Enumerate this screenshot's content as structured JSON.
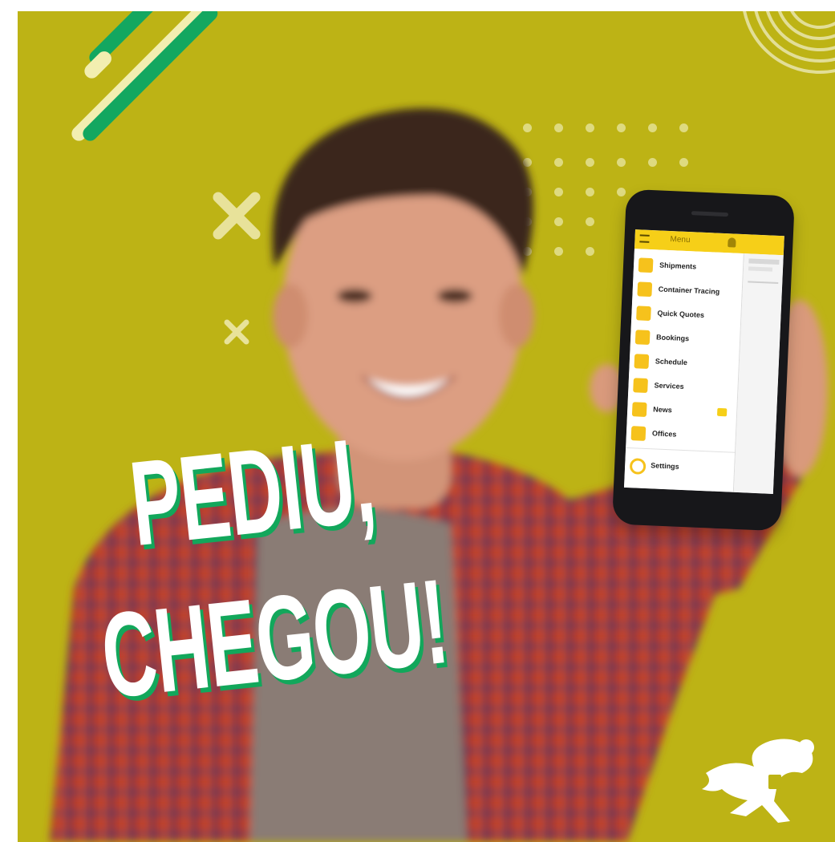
{
  "headline": {
    "line1": "PEDIU,",
    "line2": "CHEGOU!"
  },
  "phone_app": {
    "title": "Menu",
    "menu_items": [
      {
        "label": "Shipments",
        "icon": "clipboard-icon"
      },
      {
        "label": "Container Tracing",
        "icon": "container-icon"
      },
      {
        "label": "Quick Quotes",
        "icon": "tag-icon"
      },
      {
        "label": "Bookings",
        "icon": "booking-icon"
      },
      {
        "label": "Schedule",
        "icon": "calendar-icon"
      },
      {
        "label": "Services",
        "icon": "truck-icon"
      },
      {
        "label": "News",
        "icon": "news-icon"
      },
      {
        "label": "Offices",
        "icon": "building-icon"
      },
      {
        "label": "Settings",
        "icon": "gear-icon"
      }
    ]
  },
  "colors": {
    "background": "#bdb315",
    "accent_green": "#12a75b",
    "app_yellow": "#f6cf18",
    "shirt_red": "#b53a2a",
    "text_white": "#ffffff"
  },
  "logo": {
    "icon": "running-hero-logo-icon"
  }
}
